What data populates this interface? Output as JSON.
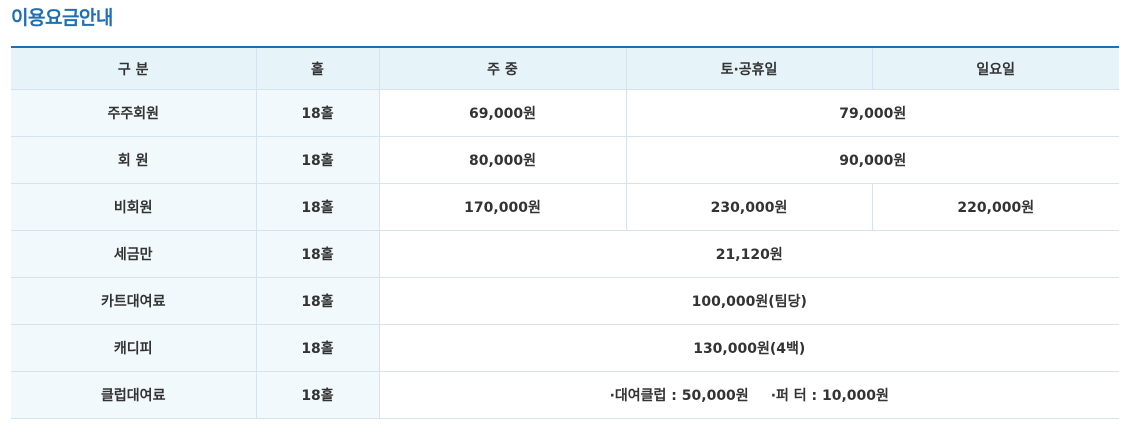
{
  "title": "이용요금안내",
  "headers": {
    "category": "구 분",
    "holes": "홀",
    "weekday": "주 중",
    "saturday_holiday": "토·공휴일",
    "sunday": "일요일"
  },
  "rows": [
    {
      "category": "주주회원",
      "holes": "18홀",
      "weekday": "69,000원",
      "weekend": "79,000원"
    },
    {
      "category": "회 원",
      "holes": "18홀",
      "weekday": "80,000원",
      "weekend": "90,000원"
    },
    {
      "category": "비회원",
      "holes": "18홀",
      "weekday": "170,000원",
      "saturday_holiday": "230,000원",
      "sunday": "220,000원"
    },
    {
      "category": "세금만",
      "holes": "18홀",
      "all": "21,120원"
    },
    {
      "category": "카트대여료",
      "holes": "18홀",
      "all": "100,000원(팀당)"
    },
    {
      "category": "캐디피",
      "holes": "18홀",
      "all": "130,000원(4백)"
    },
    {
      "category": "클럽대여료",
      "holes": "18홀",
      "club": "·대여클럽 : 50,000원",
      "putter": "·퍼 터 : 10,000원"
    }
  ]
}
